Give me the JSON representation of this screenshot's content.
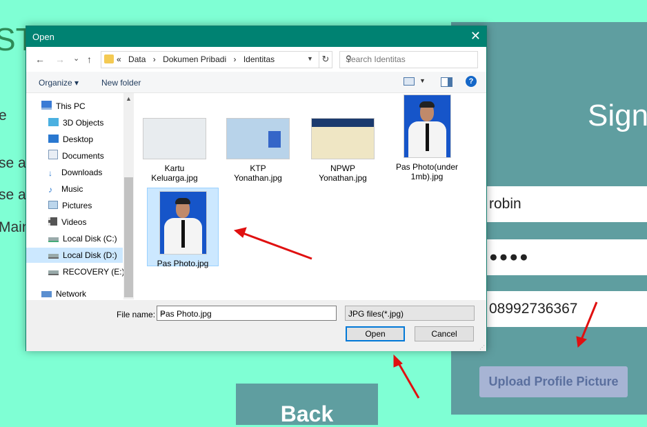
{
  "background": {
    "title_fragment": "ST",
    "lines": [
      "e",
      "se a",
      "se a",
      "Main"
    ],
    "signup_title": "Sign",
    "inputs": {
      "name": "robin",
      "password": "●●●●",
      "phone": "08992736367"
    },
    "upload_button": "Upload Profile Picture",
    "back_button": "Back"
  },
  "dialog": {
    "title": "Open",
    "close": "✕",
    "nav": {
      "back": "←",
      "forward": "→",
      "recent": "⌄",
      "up": "↑"
    },
    "breadcrumb": [
      "«",
      "Data",
      "›",
      "Dokumen Pribadi",
      "›",
      "Identitas"
    ],
    "search_placeholder": "Search Identitas",
    "toolbar": {
      "organize": "Organize ▾",
      "new_folder": "New folder",
      "help": "?"
    },
    "nav_items": [
      {
        "label": "This PC",
        "icon": "pc-icon"
      },
      {
        "label": "3D Objects",
        "icon": "3d-objects-icon"
      },
      {
        "label": "Desktop",
        "icon": "desktop-icon"
      },
      {
        "label": "Documents",
        "icon": "documents-icon"
      },
      {
        "label": "Downloads",
        "icon": "downloads-icon"
      },
      {
        "label": "Music",
        "icon": "music-icon"
      },
      {
        "label": "Pictures",
        "icon": "pictures-icon"
      },
      {
        "label": "Videos",
        "icon": "videos-icon"
      },
      {
        "label": "Local Disk (C:)",
        "icon": "drive-icon"
      },
      {
        "label": "Local Disk (D:)",
        "icon": "drive-icon",
        "selected": true
      },
      {
        "label": "RECOVERY (E:)",
        "icon": "drive-icon"
      },
      {
        "label": "Network",
        "icon": "network-icon"
      }
    ],
    "files": [
      {
        "name": "Kartu Keluarga.jpg",
        "line1": "Kartu",
        "line2": "Keluarga.jpg"
      },
      {
        "name": "KTP Yonathan.jpg",
        "line1": "KTP",
        "line2": "Yonathan.jpg"
      },
      {
        "name": "NPWP Yonathan.jpg",
        "line1": "NPWP",
        "line2": "Yonathan.jpg"
      },
      {
        "name": "Pas Photo(under 1mb).jpg",
        "line1": "Pas Photo(under",
        "line2": "1mb).jpg"
      },
      {
        "name": "Pas Photo.jpg",
        "line1": "Pas Photo.jpg",
        "line2": "",
        "selected": true
      }
    ],
    "file_name_label": "File name:",
    "file_name_value": "Pas Photo.jpg",
    "file_type": "JPG files(*.jpg)",
    "open_button": "Open",
    "cancel_button": "Cancel"
  },
  "colors": {
    "page_bg": "#7fffd4",
    "titlebar": "#008272",
    "panel": "#5f9ea0",
    "arrow": "#e01010"
  }
}
